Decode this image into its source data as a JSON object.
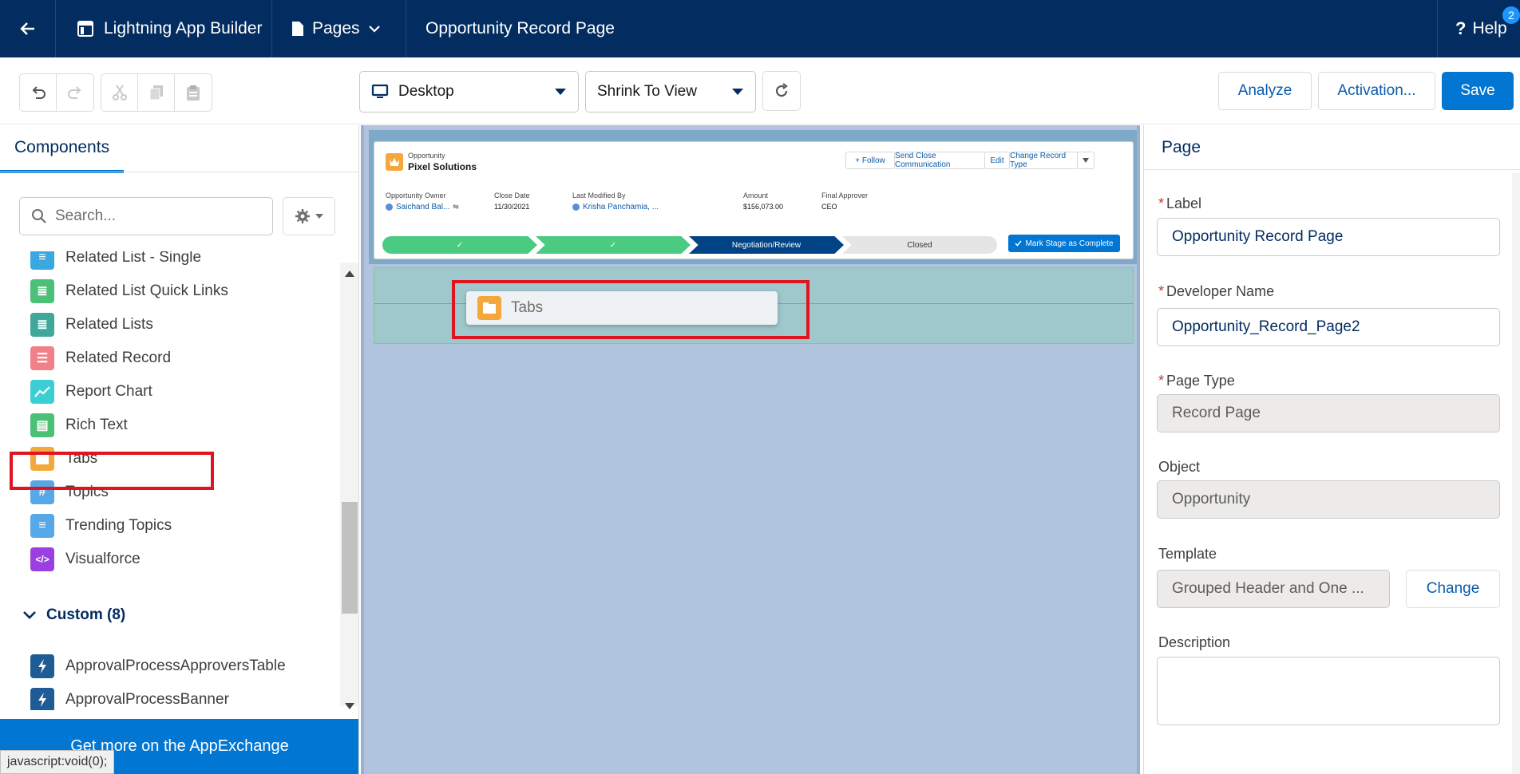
{
  "topbar": {
    "app_name": "Lightning App Builder",
    "pages_label": "Pages",
    "page_title": "Opportunity Record Page",
    "help_label": "Help",
    "help_badge": "2"
  },
  "toolbar": {
    "device": "Desktop",
    "view": "Shrink To View",
    "analyze": "Analyze",
    "activation": "Activation...",
    "save": "Save"
  },
  "left": {
    "tab": "Components",
    "search_placeholder": "Search...",
    "items": [
      {
        "label": "Related List - Single",
        "icon": "related-list-single-icon",
        "color": "#3ba7e0"
      },
      {
        "label": "Related List Quick Links",
        "icon": "related-list-quick-links-icon",
        "color": "#4bc076"
      },
      {
        "label": "Related Lists",
        "icon": "related-lists-icon",
        "color": "#3fa89a"
      },
      {
        "label": "Related Record",
        "icon": "related-record-icon",
        "color": "#f0808a"
      },
      {
        "label": "Report Chart",
        "icon": "report-chart-icon",
        "color": "#3bcfd4"
      },
      {
        "label": "Rich Text",
        "icon": "rich-text-icon",
        "color": "#4bc076"
      },
      {
        "label": "Tabs",
        "icon": "tabs-icon",
        "color": "#f4a73d"
      },
      {
        "label": "Topics",
        "icon": "topics-icon",
        "color": "#56a8e8"
      },
      {
        "label": "Trending Topics",
        "icon": "trending-topics-icon",
        "color": "#56a8e8"
      },
      {
        "label": "Visualforce",
        "icon": "visualforce-icon",
        "color": "#9b3fe0"
      }
    ],
    "custom_header": "Custom (8)",
    "custom_items": [
      {
        "label": "ApprovalProcessApproversTable"
      },
      {
        "label": "ApprovalProcessBanner"
      }
    ],
    "appexchange": "Get more on the AppExchange",
    "status_text": "javascript:void(0);"
  },
  "canvas": {
    "record": {
      "object": "Opportunity",
      "name": "Pixel Solutions",
      "buttons": [
        "+ Follow",
        "Send Close Communication",
        "Edit",
        "Change Record Type"
      ],
      "fields": [
        {
          "label": "Opportunity Owner",
          "value": "Saichand Bal..."
        },
        {
          "label": "Close Date",
          "value": "11/30/2021"
        },
        {
          "label": "Last Modified By",
          "value": "Krisha Panchamia, ..."
        },
        {
          "label": "Amount",
          "value": "$156,073.00"
        },
        {
          "label": "Final Approver",
          "value": "CEO"
        }
      ],
      "path": [
        "✓",
        "✓",
        "Negotiation/Review",
        "Closed"
      ],
      "mark_complete": "Mark Stage as Complete"
    },
    "dragging": "Tabs"
  },
  "right": {
    "heading": "Page",
    "label_label": "Label",
    "label_value": "Opportunity Record Page",
    "dev_label": "Developer Name",
    "dev_value": "Opportunity_Record_Page2",
    "type_label": "Page Type",
    "type_value": "Record Page",
    "object_label": "Object",
    "object_value": "Opportunity",
    "template_label": "Template",
    "template_value": "Grouped Header and One ...",
    "change": "Change",
    "description_label": "Description",
    "description_value": ""
  }
}
